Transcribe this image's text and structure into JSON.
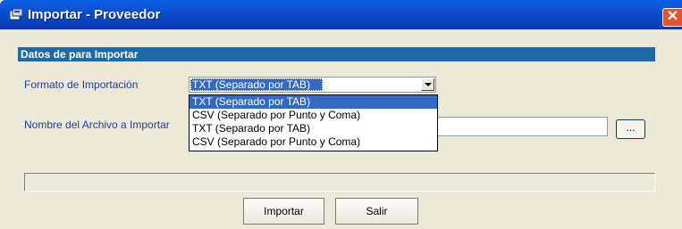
{
  "window": {
    "title": "Importar - Proveedor",
    "close_symbol": "✕"
  },
  "section": {
    "header": "Datos de para  Importar"
  },
  "format": {
    "label": "Formato de Importación",
    "selected": "TXT (Separado por TAB)",
    "options": [
      "TXT (Separado por TAB)",
      "CSV (Separado por Punto y Coma)",
      "TXT (Separado por TAB)",
      "CSV (Separado por Punto y Coma)"
    ]
  },
  "file": {
    "label": "Nombre del Archivo a Importar",
    "value": "",
    "browse_label": "..."
  },
  "progress": {
    "value": 0
  },
  "buttons": {
    "import_label": "Importar",
    "exit_label": "Salir"
  }
}
